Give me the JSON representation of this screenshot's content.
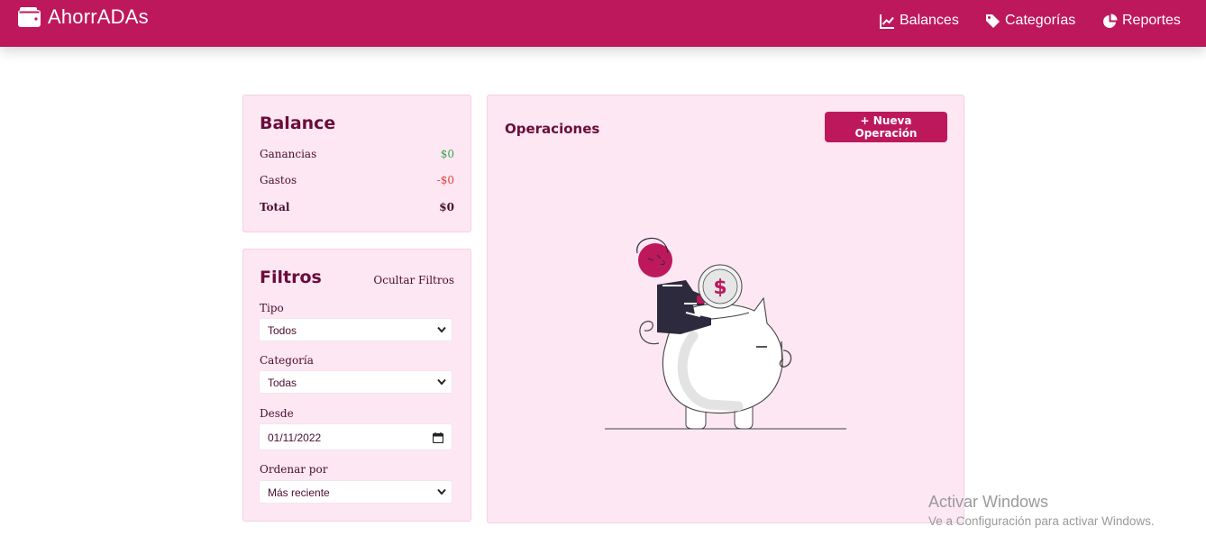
{
  "app": {
    "name": "AhorrADAs",
    "icon": "wallet-icon"
  },
  "nav": {
    "items": [
      {
        "label": "Balances",
        "icon": "chart-line-icon"
      },
      {
        "label": "Categorías",
        "icon": "tag-icon"
      },
      {
        "label": "Reportes",
        "icon": "pie-chart-icon"
      }
    ]
  },
  "balance": {
    "title": "Balance",
    "rows": [
      {
        "label": "Ganancias",
        "value": "$0",
        "color": "#3aa64e"
      },
      {
        "label": "Gastos",
        "value": "-$0",
        "color": "#e0403a"
      },
      {
        "label": "Total",
        "value": "$0",
        "color": "#4a0d2c"
      }
    ]
  },
  "filters": {
    "title": "Filtros",
    "toggle_label": "Ocultar Filtros",
    "tipo": {
      "label": "Tipo",
      "value": "Todos"
    },
    "categoria": {
      "label": "Categoría",
      "value": "Todas"
    },
    "desde": {
      "label": "Desde",
      "value": "01/11/2022"
    },
    "orden": {
      "label": "Ordenar por",
      "value": "Más reciente"
    }
  },
  "operations": {
    "title": "Operaciones",
    "new_button": "+ Nueva Operación",
    "illustration": "piggy-bank-illustration"
  },
  "watermark": {
    "line1": "Activar Windows",
    "line2": "Ve a Configuración para activar Windows."
  },
  "colors": {
    "primary": "#be185d",
    "card_bg": "#fce7f3",
    "text": "#6b0c3a"
  }
}
